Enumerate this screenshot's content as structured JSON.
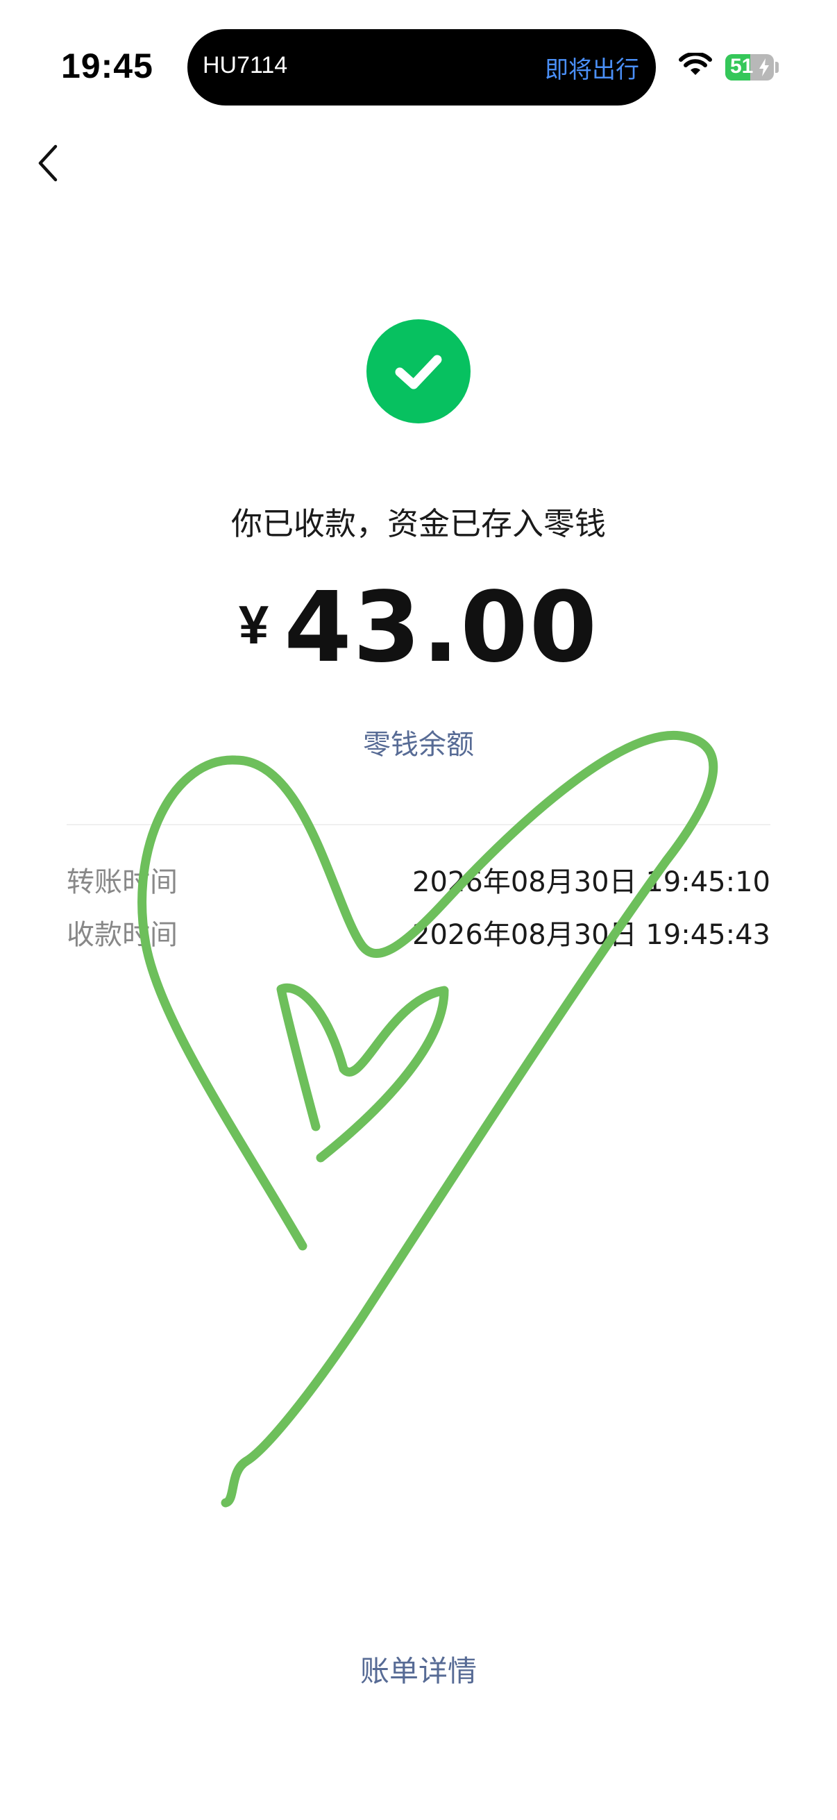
{
  "status_bar": {
    "time": "19:45",
    "island": {
      "flight": "HU7114",
      "status": "即将出行"
    },
    "battery": {
      "level": "51",
      "fraction": 0.51,
      "fill_color": "#34c759"
    },
    "icons": [
      "wifi-icon",
      "battery-icon",
      "charging-bolt-icon"
    ]
  },
  "nav": {
    "back_icon": "chevron-left-icon"
  },
  "receipt": {
    "status_icon": "checkmark-icon",
    "status_color": "#07c160",
    "headline": "你已收款，资金已存入零钱",
    "currency": "¥",
    "amount": "43.00",
    "balance_link": "零钱余额",
    "details": [
      {
        "label": "转账时间",
        "value": "2026年08月30日 19:45:10"
      },
      {
        "label": "收款时间",
        "value": "2026年08月30日 19:45:43"
      }
    ]
  },
  "annotation": {
    "shape": "heart-scribble",
    "color": "#6dbf5b"
  },
  "footer": {
    "bill_link": "账单详情"
  },
  "colors": {
    "link": "#576b95",
    "accent": "#07c160",
    "island_text": "#4a8ff7"
  }
}
